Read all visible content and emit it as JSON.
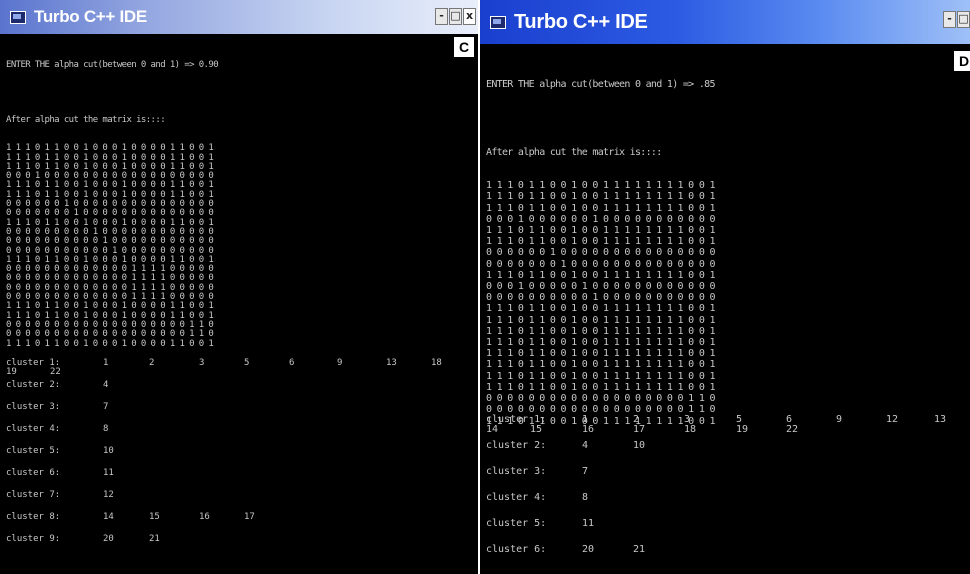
{
  "win_c": {
    "title": "Turbo C++ IDE",
    "badge": "C",
    "controls": [
      "-",
      "□",
      "x"
    ],
    "prompt": "ENTER THE alpha cut(between 0 and 1) => 0.90",
    "heading": "After alpha cut the matrix is::::",
    "matrix": [
      "1 1 1 0 1 1 0 0 1 0 0 0 1 0 0 0 0 1 1 0 0 1",
      "1 1 1 0 1 1 0 0 1 0 0 0 1 0 0 0 0 1 1 0 0 1",
      "1 1 1 0 1 1 0 0 1 0 0 0 1 0 0 0 0 1 1 0 0 1",
      "0 0 0 1 0 0 0 0 0 0 0 0 0 0 0 0 0 0 0 0 0 0",
      "1 1 1 0 1 1 0 0 1 0 0 0 1 0 0 0 0 1 1 0 0 1",
      "1 1 1 0 1 1 0 0 1 0 0 0 1 0 0 0 0 1 1 0 0 1",
      "0 0 0 0 0 0 1 0 0 0 0 0 0 0 0 0 0 0 0 0 0 0",
      "0 0 0 0 0 0 0 1 0 0 0 0 0 0 0 0 0 0 0 0 0 0",
      "1 1 1 0 1 1 0 0 1 0 0 0 1 0 0 0 0 1 1 0 0 1",
      "0 0 0 0 0 0 0 0 0 1 0 0 0 0 0 0 0 0 0 0 0 0",
      "0 0 0 0 0 0 0 0 0 0 1 0 0 0 0 0 0 0 0 0 0 0",
      "0 0 0 0 0 0 0 0 0 0 0 1 0 0 0 0 0 0 0 0 0 0",
      "1 1 1 0 1 1 0 0 1 0 0 0 1 0 0 0 0 1 1 0 0 1",
      "0 0 0 0 0 0 0 0 0 0 0 0 0 1 1 1 1 0 0 0 0 0",
      "0 0 0 0 0 0 0 0 0 0 0 0 0 1 1 1 1 0 0 0 0 0",
      "0 0 0 0 0 0 0 0 0 0 0 0 0 1 1 1 1 0 0 0 0 0",
      "0 0 0 0 0 0 0 0 0 0 0 0 0 1 1 1 1 0 0 0 0 0",
      "1 1 1 0 1 1 0 0 1 0 0 0 1 0 0 0 0 1 1 0 0 1",
      "1 1 1 0 1 1 0 0 1 0 0 0 1 0 0 0 0 1 1 0 0 1",
      "0 0 0 0 0 0 0 0 0 0 0 0 0 0 0 0 0 0 0 1 1 0",
      "0 0 0 0 0 0 0 0 0 0 0 0 0 0 0 0 0 0 0 1 1 0",
      "1 1 1 0 1 1 0 0 1 0 0 0 1 0 0 0 0 1 1 0 0 1"
    ],
    "clusters": [
      {
        "label": "cluster 1:",
        "values": [
          "1",
          "2",
          "3",
          "5",
          "6",
          "9",
          "13",
          "18"
        ],
        "wrap": [
          "19",
          "22"
        ]
      },
      {
        "label": "cluster 2:",
        "values": [
          "4"
        ]
      },
      {
        "label": "cluster 3:",
        "values": [
          "7"
        ]
      },
      {
        "label": "cluster 4:",
        "values": [
          "8"
        ]
      },
      {
        "label": "cluster 5:",
        "values": [
          "10"
        ]
      },
      {
        "label": "cluster 6:",
        "values": [
          "11"
        ]
      },
      {
        "label": "cluster 7:",
        "values": [
          "12"
        ]
      },
      {
        "label": "cluster 8:",
        "values": [
          "14",
          "15",
          "16",
          "17"
        ]
      },
      {
        "label": "cluster 9:",
        "values": [
          "20",
          "21"
        ]
      }
    ]
  },
  "win_d": {
    "title": "Turbo C++ IDE",
    "badge": "D",
    "controls": [
      "-",
      "□"
    ],
    "prompt": "ENTER THE alpha cut(between 0 and 1) => .85",
    "heading": "After alpha cut the matrix is::::",
    "matrix": [
      "1 1 1 0 1 1 0 0 1 0 0 1 1 1 1 1 1 1 1 0 0 1",
      "1 1 1 0 1 1 0 0 1 0 0 1 1 1 1 1 1 1 1 0 0 1",
      "1 1 1 0 1 1 0 0 1 0 0 1 1 1 1 1 1 1 1 0 0 1",
      "0 0 0 1 0 0 0 0 0 0 1 0 0 0 0 0 0 0 0 0 0 0",
      "1 1 1 0 1 1 0 0 1 0 0 1 1 1 1 1 1 1 1 0 0 1",
      "1 1 1 0 1 1 0 0 1 0 0 1 1 1 1 1 1 1 1 0 0 1",
      "0 0 0 0 0 0 1 0 0 0 0 0 0 0 0 0 0 0 0 0 0 0",
      "0 0 0 0 0 0 0 1 0 0 0 0 0 0 0 0 0 0 0 0 0 0",
      "1 1 1 0 1 1 0 0 1 0 0 1 1 1 1 1 1 1 1 0 0 1",
      "0 0 0 1 0 0 0 0 0 1 0 0 0 0 0 0 0 0 0 0 0 0",
      "0 0 0 0 0 0 0 0 0 0 1 0 0 0 0 0 0 0 0 0 0 0",
      "1 1 1 0 1 1 0 0 1 0 0 1 1 1 1 1 1 1 1 0 0 1",
      "1 1 1 0 1 1 0 0 1 0 0 1 1 1 1 1 1 1 1 0 0 1",
      "1 1 1 0 1 1 0 0 1 0 0 1 1 1 1 1 1 1 1 0 0 1",
      "1 1 1 0 1 1 0 0 1 0 0 1 1 1 1 1 1 1 1 0 0 1",
      "1 1 1 0 1 1 0 0 1 0 0 1 1 1 1 1 1 1 1 0 0 1",
      "1 1 1 0 1 1 0 0 1 0 0 1 1 1 1 1 1 1 1 0 0 1",
      "1 1 1 0 1 1 0 0 1 0 0 1 1 1 1 1 1 1 1 0 0 1",
      "1 1 1 0 1 1 0 0 1 0 0 1 1 1 1 1 1 1 1 0 0 1",
      "0 0 0 0 0 0 0 0 0 0 0 0 0 0 0 0 0 0 0 1 1 0",
      "0 0 0 0 0 0 0 0 0 0 0 0 0 0 0 0 0 0 0 1 1 0",
      "1 1 1 0 1 1 0 0 1 0 0 1 1 1 1 1 1 1 1 0 0 1"
    ],
    "clusters": [
      {
        "label": "cluster 1:",
        "values": [
          "1",
          "2",
          "3",
          "5",
          "6",
          "9",
          "12",
          "13"
        ],
        "wrap_first": "14",
        "wrap": [
          "15",
          "16",
          "17",
          "18",
          "19",
          "22"
        ]
      },
      {
        "label": "cluster 2:",
        "values": [
          "4",
          "10"
        ]
      },
      {
        "label": "cluster 3:",
        "values": [
          "7"
        ]
      },
      {
        "label": "cluster 4:",
        "values": [
          "8"
        ]
      },
      {
        "label": "cluster 5:",
        "values": [
          "11"
        ]
      },
      {
        "label": "cluster 6:",
        "values": [
          "20",
          "21"
        ]
      }
    ]
  }
}
